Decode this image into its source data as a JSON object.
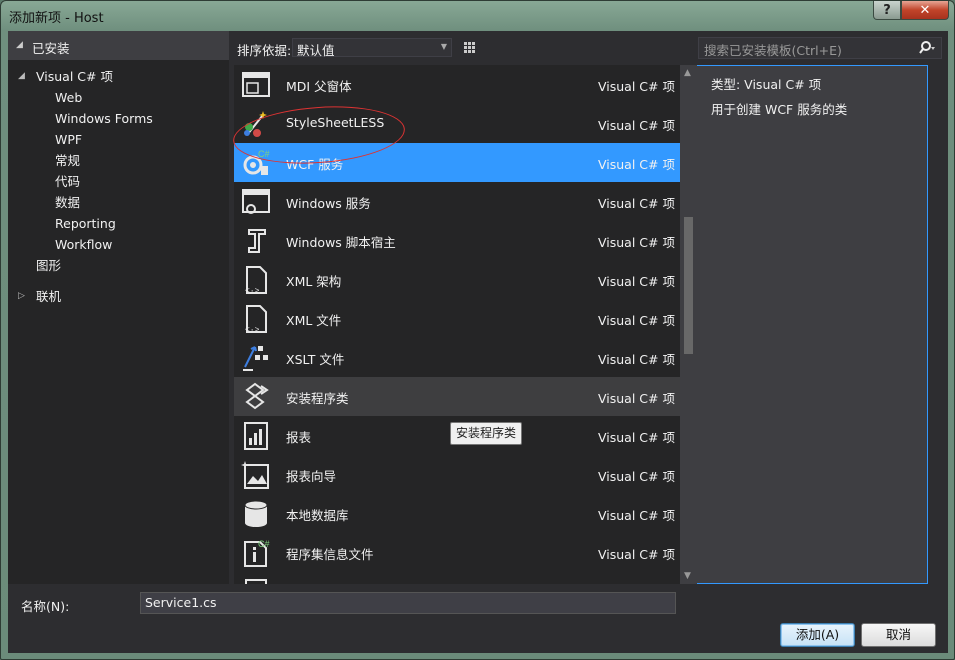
{
  "window": {
    "title": "添加新项 - Host",
    "help": "?",
    "close": "✕"
  },
  "left_panel": {
    "header": "已安装",
    "tree": [
      {
        "label": "Visual C# 项",
        "level": 0,
        "expanded": true,
        "selected": true
      },
      {
        "label": "Web",
        "level": 1
      },
      {
        "label": "Windows Forms",
        "level": 1
      },
      {
        "label": "WPF",
        "level": 1
      },
      {
        "label": "常规",
        "level": 1
      },
      {
        "label": "代码",
        "level": 1
      },
      {
        "label": "数据",
        "level": 1
      },
      {
        "label": "Reporting",
        "level": 1
      },
      {
        "label": "Workflow",
        "level": 1
      },
      {
        "label": "图形",
        "level": 0
      },
      {
        "label": "联机",
        "level": 0,
        "collapsed": true
      }
    ]
  },
  "toolbar": {
    "sort_label": "排序依据:",
    "sort_value": "默认值"
  },
  "templates": [
    {
      "name": "MDI 父窗体",
      "type": "Visual C# 项",
      "icon": "mdi-parent-form-icon"
    },
    {
      "name": "StyleSheetLESS",
      "type": "Visual C# 项",
      "icon": "stylesheet-icon"
    },
    {
      "name": "WCF 服务",
      "type": "Visual C# 项",
      "icon": "wcf-service-icon",
      "state": "selected"
    },
    {
      "name": "Windows 服务",
      "type": "Visual C# 项",
      "icon": "windows-service-icon"
    },
    {
      "name": "Windows 脚本宿主",
      "type": "Visual C# 项",
      "icon": "script-host-icon"
    },
    {
      "name": "XML 架构",
      "type": "Visual C# 项",
      "icon": "xml-schema-icon"
    },
    {
      "name": "XML 文件",
      "type": "Visual C# 项",
      "icon": "xml-file-icon"
    },
    {
      "name": "XSLT 文件",
      "type": "Visual C# 项",
      "icon": "xslt-file-icon"
    },
    {
      "name": "安装程序类",
      "type": "Visual C# 项",
      "icon": "installer-class-icon",
      "state": "hover"
    },
    {
      "name": "报表",
      "type": "Visual C# 项",
      "icon": "report-icon"
    },
    {
      "name": "报表向导",
      "type": "Visual C# 项",
      "icon": "report-wizard-icon"
    },
    {
      "name": "本地数据库",
      "type": "Visual C# 项",
      "icon": "local-database-icon"
    },
    {
      "name": "程序集信息文件",
      "type": "Visual C# 项",
      "icon": "assembly-info-icon"
    }
  ],
  "tooltip": "安装程序类",
  "search": {
    "placeholder": "搜索已安装模板(Ctrl+E)"
  },
  "details": {
    "type_line": "类型:  Visual C# 项",
    "description": "用于创建 WCF 服务的类"
  },
  "bottom": {
    "name_label": "名称(N):",
    "name_value": "Service1.cs",
    "add_label": "添加(A)",
    "cancel_label": "取消"
  },
  "colors": {
    "selection": "#3399ff",
    "background": "#2d2d30",
    "annotation_circle": "#dd3333"
  }
}
